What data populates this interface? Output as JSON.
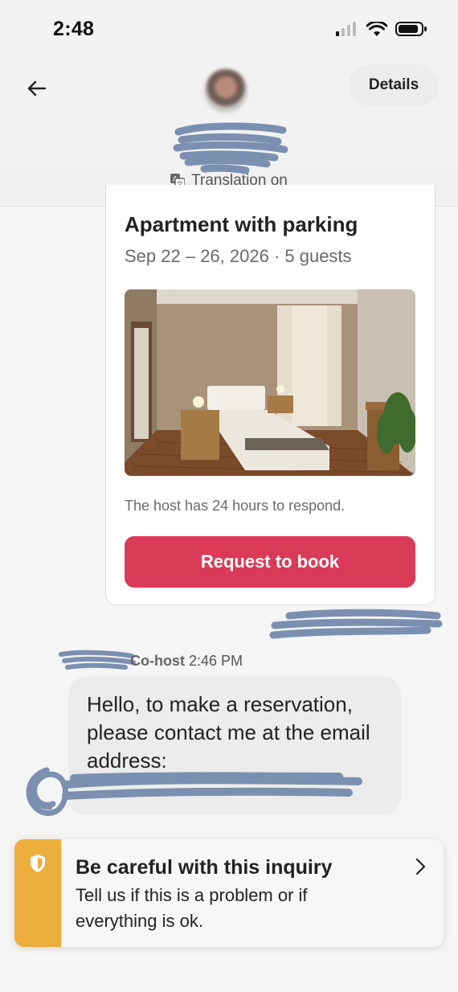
{
  "status_bar": {
    "time": "2:48"
  },
  "header": {
    "details_label": "Details",
    "translation_label": "Translation on"
  },
  "listing": {
    "title": "Apartment with parking",
    "dates": "Sep 22 – 26, 2026 · 5 guests",
    "respond_note": "The host has 24 hours to respond.",
    "request_button": "Request to book"
  },
  "message": {
    "sender_role": "Co-host",
    "time": "2:46 PM",
    "text": "Hello, to make a reservation, please contact me at the email address:"
  },
  "warning": {
    "title": "Be careful with this inquiry",
    "body": "Tell us if this is a problem or if everything is ok."
  },
  "colors": {
    "accent": "#d93b58",
    "warning": "#ecae3c",
    "redaction": "#7b8fb0"
  },
  "icons": [
    "back-arrow-icon",
    "translate-icon",
    "shield-icon",
    "chevron-right-icon",
    "signal-icon",
    "wifi-icon",
    "battery-icon"
  ]
}
